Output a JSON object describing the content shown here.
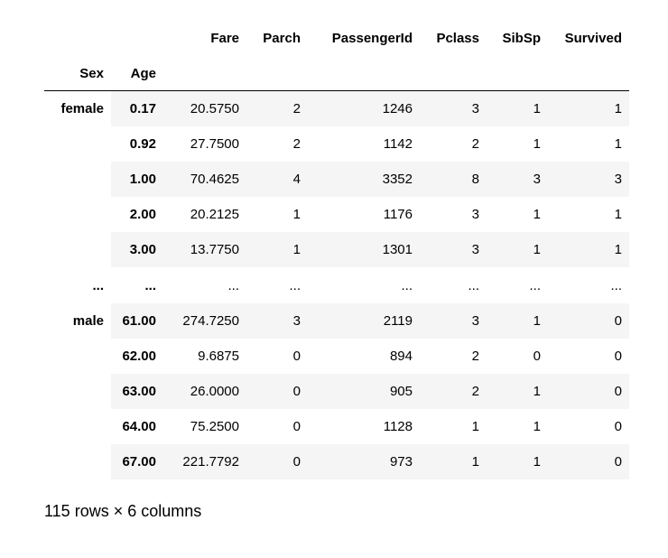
{
  "columns": [
    "Fare",
    "Parch",
    "PassengerId",
    "Pclass",
    "SibSp",
    "Survived"
  ],
  "index_names": [
    "Sex",
    "Age"
  ],
  "rows": [
    {
      "sex": "female",
      "age": "0.17",
      "values": [
        "20.5750",
        "2",
        "1246",
        "3",
        "1",
        "1"
      ]
    },
    {
      "sex": "",
      "age": "0.92",
      "values": [
        "27.7500",
        "2",
        "1142",
        "2",
        "1",
        "1"
      ]
    },
    {
      "sex": "",
      "age": "1.00",
      "values": [
        "70.4625",
        "4",
        "3352",
        "8",
        "3",
        "3"
      ]
    },
    {
      "sex": "",
      "age": "2.00",
      "values": [
        "20.2125",
        "1",
        "1176",
        "3",
        "1",
        "1"
      ]
    },
    {
      "sex": "",
      "age": "3.00",
      "values": [
        "13.7750",
        "1",
        "1301",
        "3",
        "1",
        "1"
      ]
    },
    {
      "sex": "...",
      "age": "...",
      "values": [
        "...",
        "...",
        "...",
        "...",
        "...",
        "..."
      ]
    },
    {
      "sex": "male",
      "age": "61.00",
      "values": [
        "274.7250",
        "3",
        "2119",
        "3",
        "1",
        "0"
      ]
    },
    {
      "sex": "",
      "age": "62.00",
      "values": [
        "9.6875",
        "0",
        "894",
        "2",
        "0",
        "0"
      ]
    },
    {
      "sex": "",
      "age": "63.00",
      "values": [
        "26.0000",
        "0",
        "905",
        "2",
        "1",
        "0"
      ]
    },
    {
      "sex": "",
      "age": "64.00",
      "values": [
        "75.2500",
        "0",
        "1128",
        "1",
        "1",
        "0"
      ]
    },
    {
      "sex": "",
      "age": "67.00",
      "values": [
        "221.7792",
        "0",
        "973",
        "1",
        "1",
        "0"
      ]
    }
  ],
  "footer": "115 rows × 6 columns"
}
